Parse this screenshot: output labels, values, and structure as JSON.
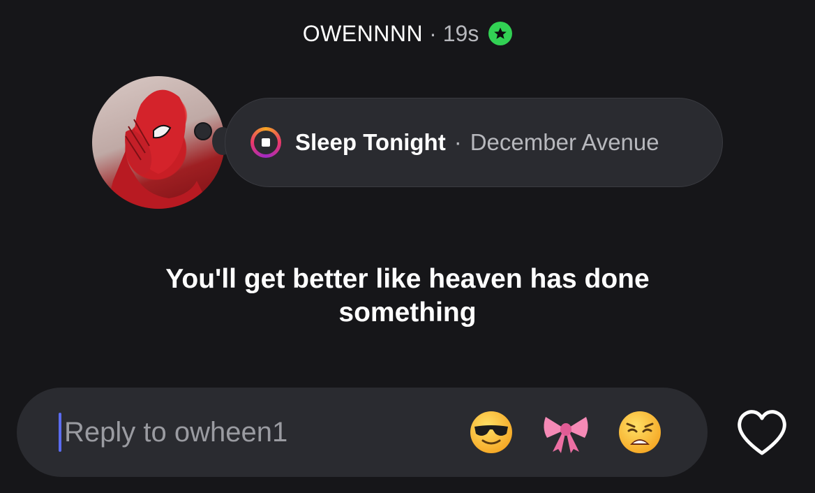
{
  "header": {
    "username": "OWENNNN",
    "separator": "·",
    "time": "19s",
    "badge_icon": "star-badge-icon",
    "badge_color": "#32d154"
  },
  "music": {
    "icon": "music-stop-icon",
    "song": "Sleep Tonight",
    "separator": "·",
    "artist": "December Avenue"
  },
  "caption": "You'll get better like heaven has done something",
  "reply": {
    "placeholder": "Reply to owheen1",
    "reactions": [
      "smiling-face-with-sunglasses-emoji",
      "pink-ribbon-emoji",
      "weary-face-emoji"
    ]
  },
  "like_icon": "heart-outline-icon"
}
